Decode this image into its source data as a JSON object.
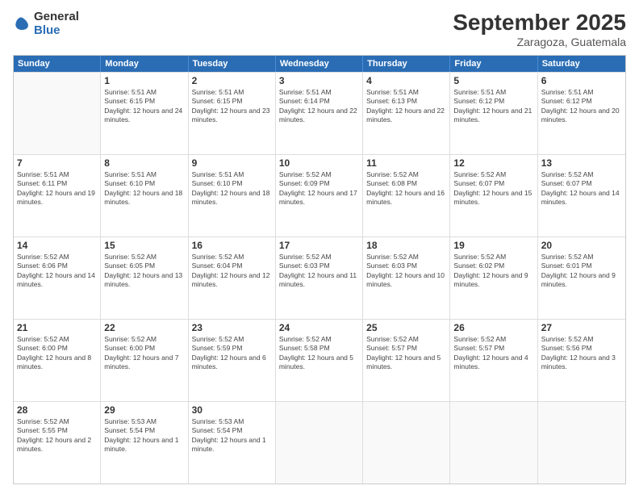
{
  "header": {
    "logo": {
      "general": "General",
      "blue": "Blue"
    },
    "title": "September 2025",
    "location": "Zaragoza, Guatemala"
  },
  "weekdays": [
    "Sunday",
    "Monday",
    "Tuesday",
    "Wednesday",
    "Thursday",
    "Friday",
    "Saturday"
  ],
  "weeks": [
    [
      {
        "day": null
      },
      {
        "day": "1",
        "sunrise": "5:51 AM",
        "sunset": "6:15 PM",
        "daylight": "12 hours and 24 minutes."
      },
      {
        "day": "2",
        "sunrise": "5:51 AM",
        "sunset": "6:15 PM",
        "daylight": "12 hours and 23 minutes."
      },
      {
        "day": "3",
        "sunrise": "5:51 AM",
        "sunset": "6:14 PM",
        "daylight": "12 hours and 22 minutes."
      },
      {
        "day": "4",
        "sunrise": "5:51 AM",
        "sunset": "6:13 PM",
        "daylight": "12 hours and 22 minutes."
      },
      {
        "day": "5",
        "sunrise": "5:51 AM",
        "sunset": "6:12 PM",
        "daylight": "12 hours and 21 minutes."
      },
      {
        "day": "6",
        "sunrise": "5:51 AM",
        "sunset": "6:12 PM",
        "daylight": "12 hours and 20 minutes."
      }
    ],
    [
      {
        "day": "7",
        "sunrise": "5:51 AM",
        "sunset": "6:11 PM",
        "daylight": "12 hours and 19 minutes."
      },
      {
        "day": "8",
        "sunrise": "5:51 AM",
        "sunset": "6:10 PM",
        "daylight": "12 hours and 18 minutes."
      },
      {
        "day": "9",
        "sunrise": "5:51 AM",
        "sunset": "6:10 PM",
        "daylight": "12 hours and 18 minutes."
      },
      {
        "day": "10",
        "sunrise": "5:52 AM",
        "sunset": "6:09 PM",
        "daylight": "12 hours and 17 minutes."
      },
      {
        "day": "11",
        "sunrise": "5:52 AM",
        "sunset": "6:08 PM",
        "daylight": "12 hours and 16 minutes."
      },
      {
        "day": "12",
        "sunrise": "5:52 AM",
        "sunset": "6:07 PM",
        "daylight": "12 hours and 15 minutes."
      },
      {
        "day": "13",
        "sunrise": "5:52 AM",
        "sunset": "6:07 PM",
        "daylight": "12 hours and 14 minutes."
      }
    ],
    [
      {
        "day": "14",
        "sunrise": "5:52 AM",
        "sunset": "6:06 PM",
        "daylight": "12 hours and 14 minutes."
      },
      {
        "day": "15",
        "sunrise": "5:52 AM",
        "sunset": "6:05 PM",
        "daylight": "12 hours and 13 minutes."
      },
      {
        "day": "16",
        "sunrise": "5:52 AM",
        "sunset": "6:04 PM",
        "daylight": "12 hours and 12 minutes."
      },
      {
        "day": "17",
        "sunrise": "5:52 AM",
        "sunset": "6:03 PM",
        "daylight": "12 hours and 11 minutes."
      },
      {
        "day": "18",
        "sunrise": "5:52 AM",
        "sunset": "6:03 PM",
        "daylight": "12 hours and 10 minutes."
      },
      {
        "day": "19",
        "sunrise": "5:52 AM",
        "sunset": "6:02 PM",
        "daylight": "12 hours and 9 minutes."
      },
      {
        "day": "20",
        "sunrise": "5:52 AM",
        "sunset": "6:01 PM",
        "daylight": "12 hours and 9 minutes."
      }
    ],
    [
      {
        "day": "21",
        "sunrise": "5:52 AM",
        "sunset": "6:00 PM",
        "daylight": "12 hours and 8 minutes."
      },
      {
        "day": "22",
        "sunrise": "5:52 AM",
        "sunset": "6:00 PM",
        "daylight": "12 hours and 7 minutes."
      },
      {
        "day": "23",
        "sunrise": "5:52 AM",
        "sunset": "5:59 PM",
        "daylight": "12 hours and 6 minutes."
      },
      {
        "day": "24",
        "sunrise": "5:52 AM",
        "sunset": "5:58 PM",
        "daylight": "12 hours and 5 minutes."
      },
      {
        "day": "25",
        "sunrise": "5:52 AM",
        "sunset": "5:57 PM",
        "daylight": "12 hours and 5 minutes."
      },
      {
        "day": "26",
        "sunrise": "5:52 AM",
        "sunset": "5:57 PM",
        "daylight": "12 hours and 4 minutes."
      },
      {
        "day": "27",
        "sunrise": "5:52 AM",
        "sunset": "5:56 PM",
        "daylight": "12 hours and 3 minutes."
      }
    ],
    [
      {
        "day": "28",
        "sunrise": "5:52 AM",
        "sunset": "5:55 PM",
        "daylight": "12 hours and 2 minutes."
      },
      {
        "day": "29",
        "sunrise": "5:53 AM",
        "sunset": "5:54 PM",
        "daylight": "12 hours and 1 minute."
      },
      {
        "day": "30",
        "sunrise": "5:53 AM",
        "sunset": "5:54 PM",
        "daylight": "12 hours and 1 minute."
      },
      {
        "day": null
      },
      {
        "day": null
      },
      {
        "day": null
      },
      {
        "day": null
      }
    ]
  ]
}
